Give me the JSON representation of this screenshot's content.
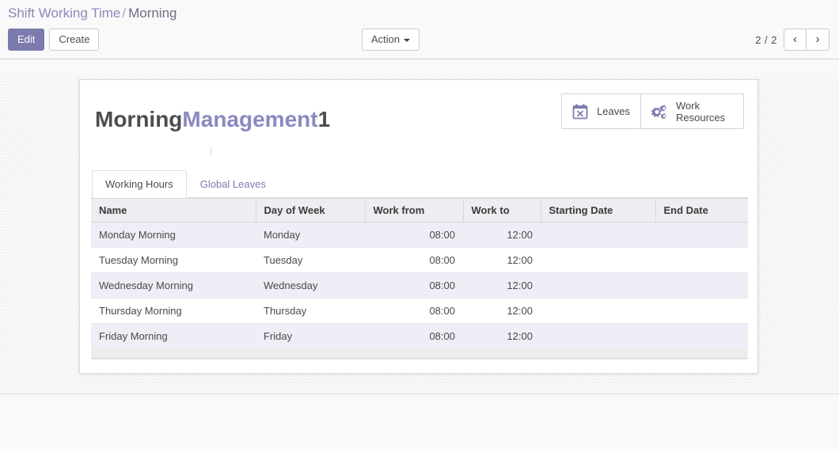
{
  "breadcrumb": {
    "parent": "Shift Working Time",
    "separator": "/",
    "current": "Morning"
  },
  "toolbar": {
    "edit_label": "Edit",
    "create_label": "Create",
    "action_label": "Action"
  },
  "pager": {
    "counter": "2 / 2",
    "prev_icon": "chevron-left-icon",
    "prev_glyph": "‹",
    "next_icon": "chevron-right-icon",
    "next_glyph": "›"
  },
  "record": {
    "title_part_a": "Morning",
    "title_part_b": "Management",
    "title_part_c": "1"
  },
  "stat_buttons": [
    {
      "label": "Leaves",
      "icon": "calendar-times-icon"
    },
    {
      "label": "Work Resources",
      "icon": "cogs-icon"
    }
  ],
  "tabs": [
    {
      "label": "Working Hours",
      "active": true
    },
    {
      "label": "Global Leaves",
      "active": false
    }
  ],
  "table": {
    "columns": [
      "Name",
      "Day of Week",
      "Work from",
      "Work to",
      "Starting Date",
      "End Date"
    ],
    "rows": [
      {
        "name": "Monday Morning",
        "day": "Monday",
        "work_from": "08:00",
        "work_to": "12:00",
        "start_date": "",
        "end_date": ""
      },
      {
        "name": "Tuesday Morning",
        "day": "Tuesday",
        "work_from": "08:00",
        "work_to": "12:00",
        "start_date": "",
        "end_date": ""
      },
      {
        "name": "Wednesday Morning",
        "day": "Wednesday",
        "work_from": "08:00",
        "work_to": "12:00",
        "start_date": "",
        "end_date": ""
      },
      {
        "name": "Thursday Morning",
        "day": "Thursday",
        "work_from": "08:00",
        "work_to": "12:00",
        "start_date": "",
        "end_date": ""
      },
      {
        "name": "Friday Morning",
        "day": "Friday",
        "work_from": "08:00",
        "work_to": "12:00",
        "start_date": "",
        "end_date": ""
      }
    ]
  },
  "colors": {
    "brand_purple": "#7c7bad",
    "title_accent": "#8a89c0",
    "breadcrumb_link": "#8a89ba",
    "row_stripe": "#eeeef6",
    "header_bg": "#eeeef2"
  }
}
